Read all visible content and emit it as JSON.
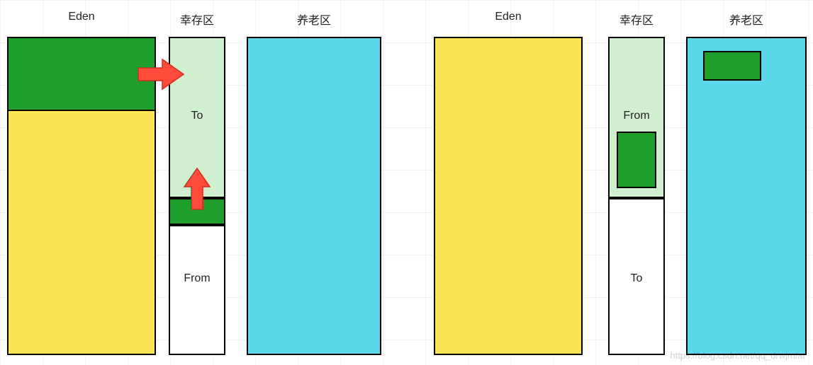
{
  "watermark": "https://blog.csdn.net/qq_drwjm/ar",
  "colors": {
    "yellow": "#fbe552",
    "green": "#1f9e2c",
    "lightGreen": "#cfefcf",
    "cyan": "#5cd8eb",
    "arrow": "#ff4b3a"
  },
  "left": {
    "eden": {
      "title": "Eden"
    },
    "survivor": {
      "title": "幸存区",
      "to": "To",
      "from": "From"
    },
    "old": {
      "title": "养老区"
    }
  },
  "right": {
    "eden": {
      "title": "Eden"
    },
    "survivor": {
      "title": "幸存区",
      "from": "From",
      "to": "To"
    },
    "old": {
      "title": "养老区"
    }
  }
}
